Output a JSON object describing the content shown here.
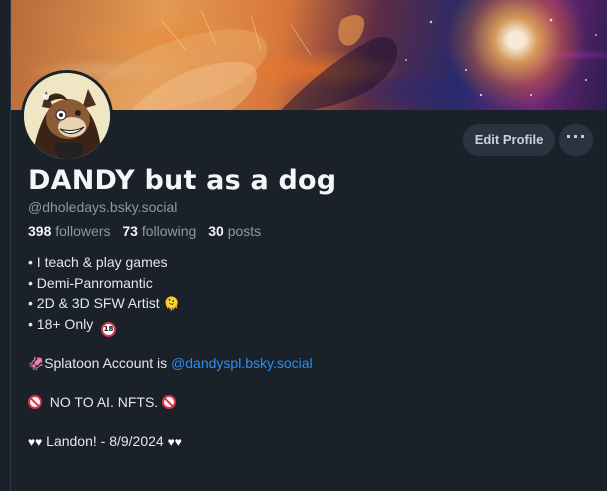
{
  "banner": {
    "description_icon": "banner-image"
  },
  "avatar": {
    "icon": "avatar-dog-illustration"
  },
  "actions": {
    "edit_label": "Edit Profile",
    "more_label": "···"
  },
  "profile": {
    "display_name": "DANDY but as a dog",
    "handle": "@dholedays.bsky.social"
  },
  "stats": {
    "followers_count": "398",
    "followers_label": "followers",
    "following_count": "73",
    "following_label": "following",
    "posts_count": "30",
    "posts_label": "posts"
  },
  "bio": {
    "line1": "• I teach & play games",
    "line2": "• Demi-Panromantic",
    "line3": "• 2D & 3D SFW Artist",
    "line3_emoji": "🫠",
    "line4": "• 18+ Only",
    "line4_badge": "18",
    "splatoon_prefix": "Splatoon Account is ",
    "splatoon_link": "@dandyspl.bsky.social",
    "squid_emoji": "🦑",
    "no_ai": "NO TO AI. NFTS.",
    "hearts": "♥♥",
    "landon": "Landon! - 8/9/2024"
  },
  "colors": {
    "background": "#1b2129",
    "link": "#2b8ef0",
    "button_bg": "#2a3441",
    "muted": "#8b98a8"
  }
}
